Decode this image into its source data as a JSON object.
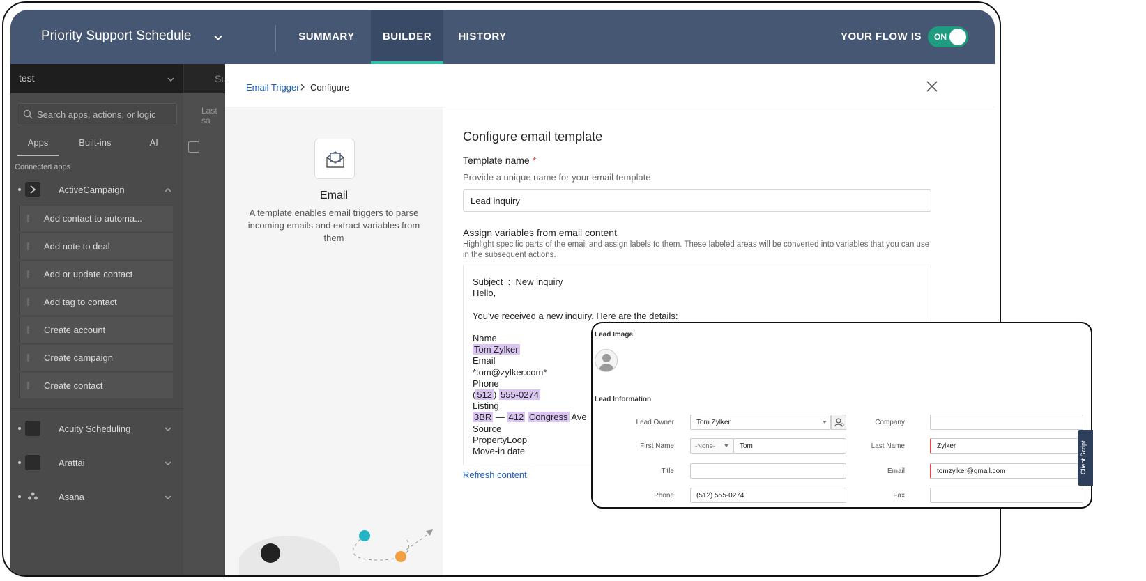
{
  "header": {
    "flow_title": "Priority Support Schedule",
    "tabs": [
      {
        "label": "SUMMARY"
      },
      {
        "label": "BUILDER"
      },
      {
        "label": "HISTORY"
      }
    ],
    "flow_status_label": "YOUR FLOW IS",
    "toggle_label": "ON"
  },
  "sidebar": {
    "flow_name": "test",
    "search_placeholder": "Search apps, actions, or logic",
    "tabs": [
      "Apps",
      "Built-ins",
      "AI"
    ],
    "section_label": "Connected apps",
    "expanded_app": "ActiveCampaign",
    "actions": [
      "Add contact to automa...",
      "Add note to deal",
      "Add or update contact",
      "Add tag to contact",
      "Create account",
      "Create campaign",
      "Create contact"
    ],
    "other_apps": [
      "Acuity Scheduling",
      "Arattai",
      "Asana"
    ]
  },
  "canvas": {
    "tab_partial": "Su",
    "last_saved_partial": "Last sa"
  },
  "panel": {
    "breadcrumb_link": "Email Trigger",
    "breadcrumb_current": "Configure",
    "left": {
      "title": "Email",
      "description": "A template enables email triggers to parse incoming emails and extract variables from them"
    },
    "title": "Configure email template",
    "template_name_label": "Template name",
    "required_mark": "*",
    "template_name_help": "Provide a unique name for your email template",
    "template_name_value": "Lead inquiry",
    "assign_label": "Assign variables from email content",
    "assign_help": "Highlight specific parts of the email and assign labels to them. These labeled areas will be converted into variables that you can use in the subsequent actions.",
    "email_lines": {
      "subject_key": "Subject",
      "subject_sep": ":",
      "subject_value": "New inquiry",
      "greeting": "Hello,",
      "intro": "You've received a new inquiry. Here are the details:",
      "name_label": "Name",
      "name_value": "Tom Zylker",
      "email_label": "Email",
      "email_value": "*tom@zylker.com*",
      "phone_label": "Phone",
      "phone_area_open": "(",
      "phone_area": "512",
      "phone_area_close": ")",
      "phone_rest": "555-0274",
      "listing_label": "Listing",
      "listing_beds": "3BR",
      "listing_dash": "—",
      "listing_num": "412",
      "listing_street": "Congress",
      "listing_suffix": "Ave",
      "source_label": "Source",
      "source_value": "PropertyLoop",
      "movein_label": "Move-in date"
    },
    "refresh_label": "Refresh content"
  },
  "lead_card": {
    "image_section": "Lead Image",
    "info_section": "Lead Information",
    "fields": {
      "lead_owner_label": "Lead Owner",
      "lead_owner_value": "Tom Zylker",
      "company_label": "Company",
      "company_value": "",
      "first_name_label": "First Name",
      "salutation_value": "-None-",
      "first_name_value": "Tom",
      "last_name_label": "Last Name",
      "last_name_value": "Zylker",
      "title_label": "Title",
      "title_value": "",
      "email_label": "Email",
      "email_value": "tomzylker@gmail.com",
      "phone_label": "Phone",
      "phone_value": "(512) 555-0274",
      "fax_label": "Fax",
      "fax_value": ""
    },
    "client_script_label": "Client Script"
  },
  "colors": {
    "header_bg": "#465773",
    "active_tab_bg": "#394a66",
    "active_tab_underline": "#2fc4a7",
    "toggle_on": "#1f9b80",
    "link": "#1a5fc0",
    "highlight": "#d9c4f2",
    "required": "#e04444"
  }
}
